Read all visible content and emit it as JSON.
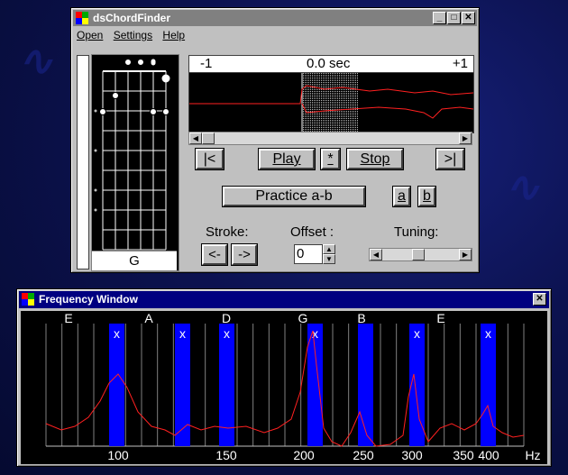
{
  "main_window": {
    "title": "dsChordFinder",
    "menu": [
      "Open",
      "Settings",
      "Help"
    ],
    "chord_name": "G",
    "timeline": {
      "left": "-1",
      "center": "0.0",
      "unit": "sec",
      "right": "+1"
    },
    "buttons": {
      "first": "|<",
      "play": "Play",
      "mark": "*",
      "stop": "Stop",
      "last": ">|",
      "practice": "Practice a-b",
      "a": "a",
      "b": "b",
      "stroke_prev": "<-",
      "stroke_next": "->"
    },
    "labels": {
      "stroke": "Stroke:",
      "offset": "Offset :",
      "tuning": "Tuning:"
    },
    "offset_value": "0",
    "tuning_level": 0.45
  },
  "freq_window": {
    "title": "Frequency Window",
    "notes": [
      "E",
      "A",
      "D",
      "G",
      "B",
      "E"
    ],
    "axis_ticks": [
      "100",
      "150",
      "200",
      "250",
      "300",
      "350",
      "400"
    ],
    "axis_unit": "Hz",
    "mark": "x"
  },
  "colors": {
    "desktop": "#0c1250",
    "title_active": "#000080",
    "title_inactive": "#808080",
    "band": "#0000ff",
    "curve": "#ff2020"
  }
}
